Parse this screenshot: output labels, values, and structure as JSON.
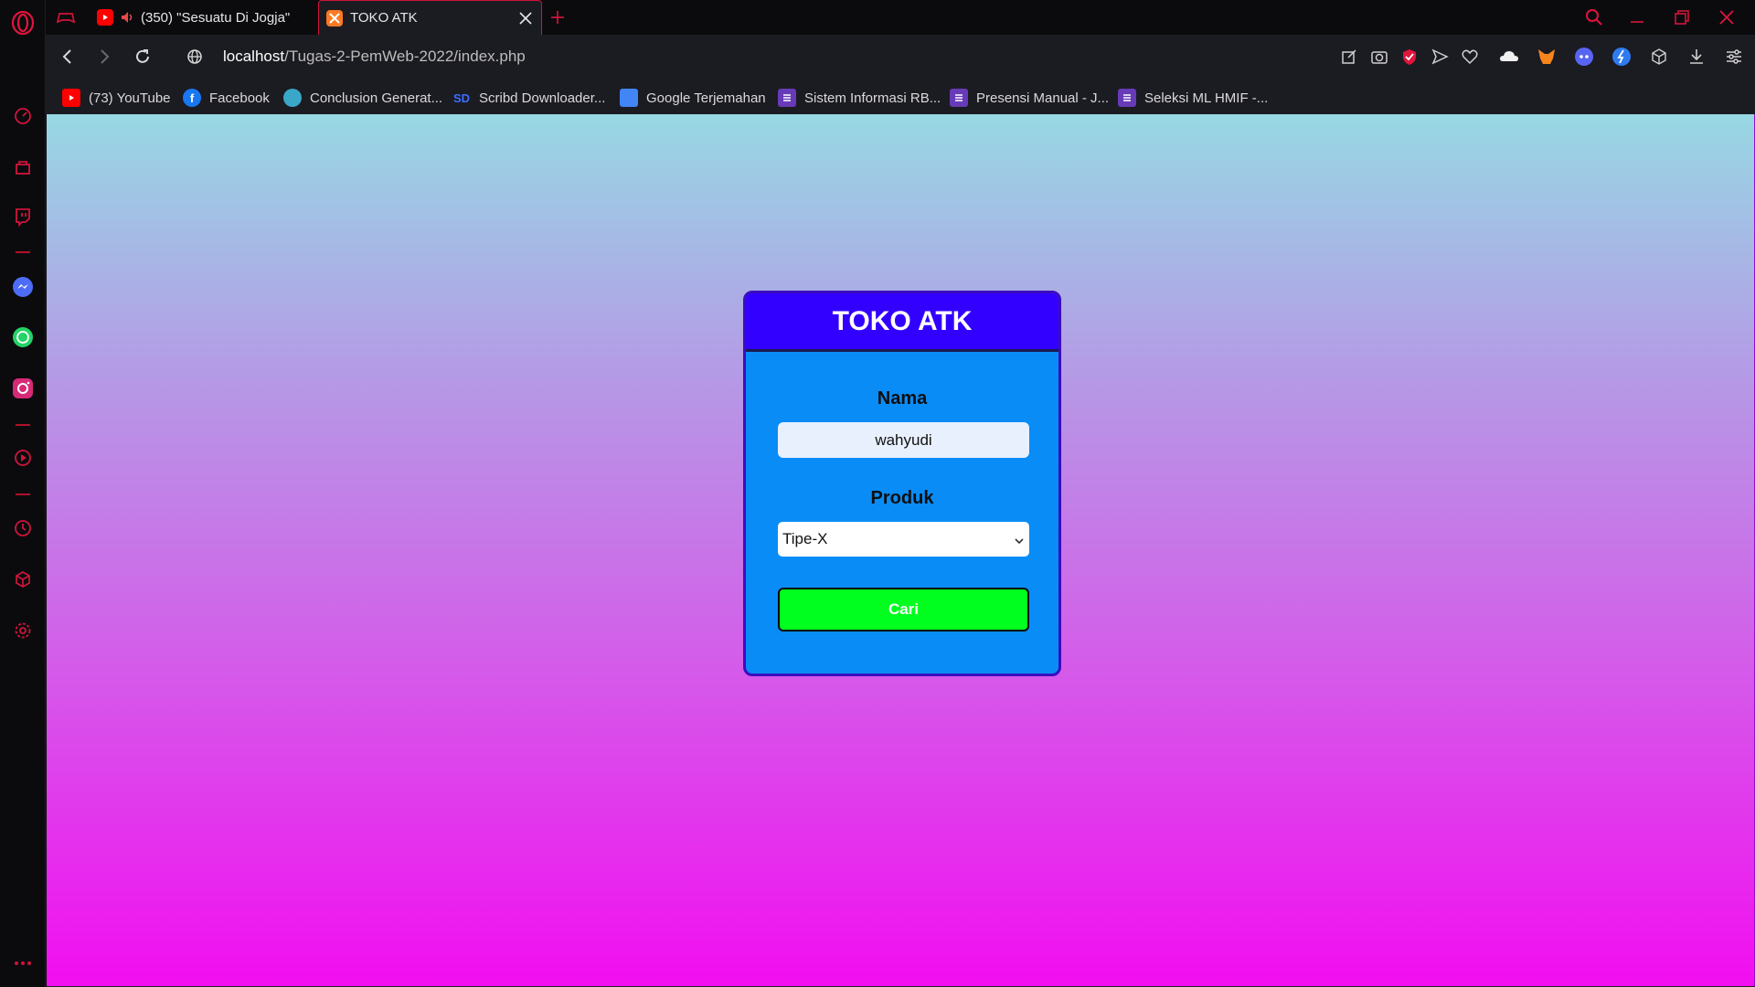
{
  "browser": {
    "tabs": [
      {
        "title": "(350) \"Sesuatu Di Jogja\"",
        "type": "youtube",
        "active": false
      },
      {
        "title": "TOKO ATK",
        "type": "site",
        "active": true
      }
    ],
    "url_host": "localhost",
    "url_path": "/Tugas-2-PemWeb-2022/index.php",
    "bookmarks": [
      {
        "label": "(73) YouTube",
        "icon": "youtube-icon"
      },
      {
        "label": "Facebook",
        "icon": "facebook-icon"
      },
      {
        "label": "Conclusion Generat...",
        "icon": "globe-icon"
      },
      {
        "label": "Scribd Downloader...",
        "icon": "sd-icon",
        "icon_text": "SD"
      },
      {
        "label": "Google Terjemahan",
        "icon": "translate-icon"
      },
      {
        "label": "Sistem Informasi RB...",
        "icon": "form-icon"
      },
      {
        "label": "Presensi Manual - J...",
        "icon": "form-icon"
      },
      {
        "label": "Seleksi ML HMIF -...",
        "icon": "form-icon"
      }
    ]
  },
  "page": {
    "title": "TOKO ATK",
    "nama_label": "Nama",
    "nama_value": "wahyudi",
    "produk_label": "Produk",
    "produk_selected": "Tipe-X",
    "submit_label": "Cari"
  },
  "colors": {
    "accent": "#d0143a",
    "card_header": "#3200ff",
    "card_body": "#0a8cf6",
    "button": "#00ff1e"
  }
}
